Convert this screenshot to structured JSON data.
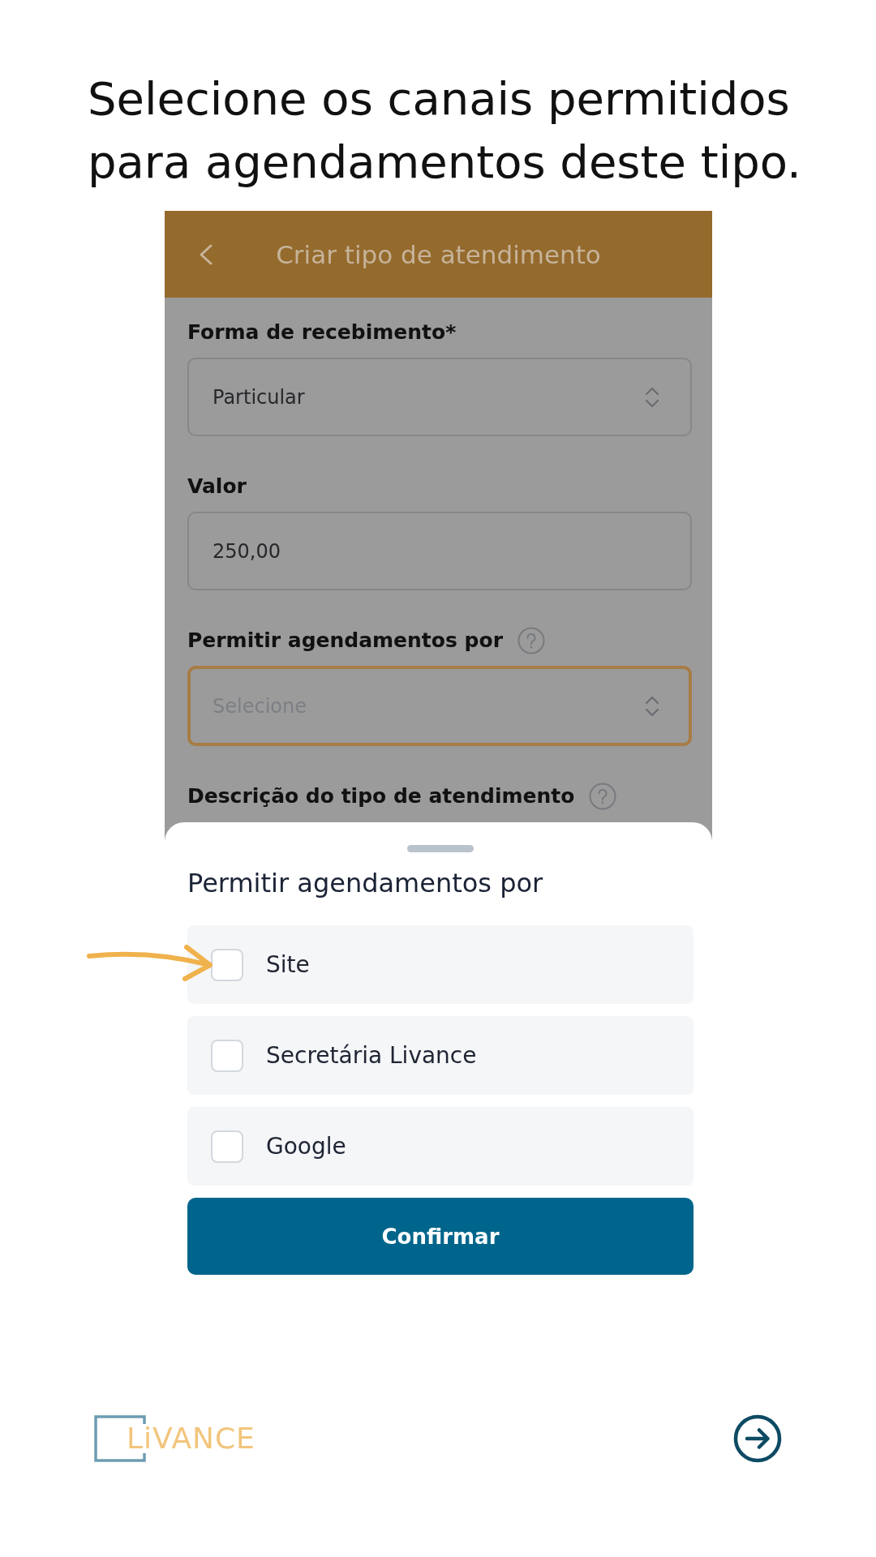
{
  "heading": "Selecione os canais permitidos para agendamentos deste tipo.",
  "app_bar": {
    "title": "Criar tipo de atendimento"
  },
  "form": {
    "fields": [
      {
        "kind": "select",
        "label": "Forma de recebimento*",
        "help": false,
        "focused": false,
        "value": "Particular"
      },
      {
        "kind": "input",
        "label": "Valor",
        "help": false,
        "focused": false,
        "value": "250,00"
      },
      {
        "kind": "select",
        "label": "Permitir agendamentos por",
        "help": true,
        "focused": true,
        "placeholder": "Selecione"
      },
      {
        "kind": "label",
        "label": "Descrição do tipo de atendimento",
        "help": true
      }
    ]
  },
  "sheet": {
    "title": "Permitir agendamentos por",
    "options": [
      {
        "label": "Site",
        "checked": false
      },
      {
        "label": "Secretária Livance",
        "checked": false
      },
      {
        "label": "Google",
        "checked": false
      }
    ],
    "confirm_button": "Confirmar"
  },
  "footer": {
    "logo": "LiVANCE"
  }
}
